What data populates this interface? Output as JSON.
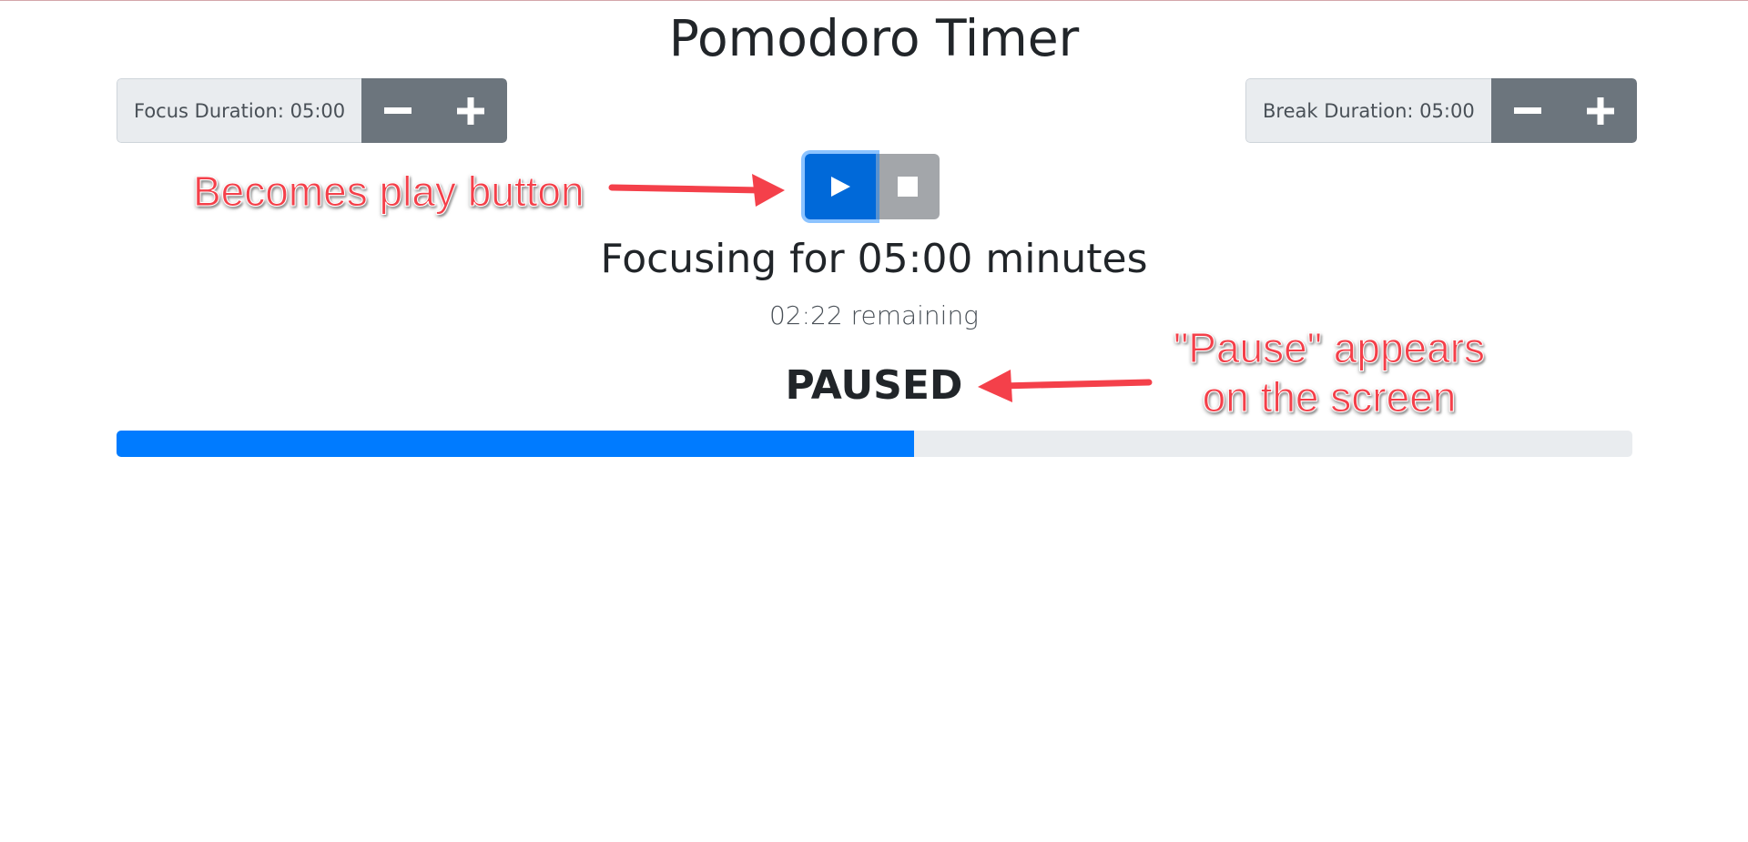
{
  "header": {
    "title": "Pomodoro Timer"
  },
  "focus": {
    "label": "Focus Duration: 05:00",
    "decrement_icon": "minus-icon",
    "increment_icon": "plus-icon"
  },
  "break": {
    "label": "Break Duration: 05:00",
    "decrement_icon": "minus-icon",
    "increment_icon": "plus-icon"
  },
  "controls": {
    "play_icon": "play-icon",
    "stop_icon": "stop-icon"
  },
  "status": {
    "heading": "Focusing for 05:00 minutes",
    "remaining": "02:22 remaining",
    "paused": "PAUSED"
  },
  "progress": {
    "fraction": 0.526
  },
  "annotations": {
    "play_button": "Becomes play button",
    "pause_line1": "\"Pause\" appears",
    "pause_line2": "on the screen"
  },
  "colors": {
    "primary": "#007bff",
    "secondary": "#6c757d",
    "annotation": "#f4404a"
  }
}
